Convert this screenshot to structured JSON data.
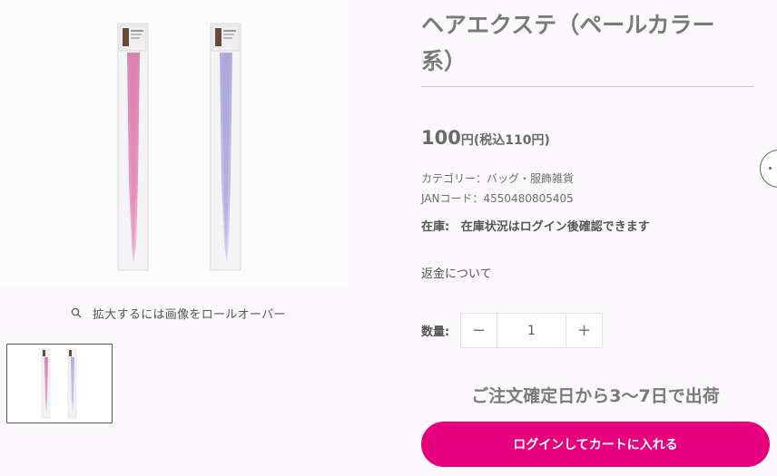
{
  "product": {
    "title": "ヘアエクステ（ペールカラー系）",
    "price": "100",
    "price_unit": "円",
    "price_tax": "(税込110円)",
    "category_line": "カテゴリー：バッグ・服飾雑貨",
    "jan_line": "JANコード：4550480805405",
    "stock_label": "在庫:",
    "stock_text": "在庫状況はログイン後確認できます",
    "refund_link": "返金について"
  },
  "gallery": {
    "zoom_hint": "拡大するには画像をロールオーバー",
    "colors": {
      "pink": "#e79bc3",
      "lavender": "#c3bde6"
    }
  },
  "quantity": {
    "label": "数量:",
    "value": "1",
    "minus": "−",
    "plus": "+"
  },
  "shipping": {
    "text": "ご注文確定日から3〜7日で出荷"
  },
  "cart": {
    "button_label": "ログインしてカートに入れる",
    "accent": "#e6007e"
  },
  "widgets": {
    "chat_icon": "chat-bubble-icon"
  }
}
